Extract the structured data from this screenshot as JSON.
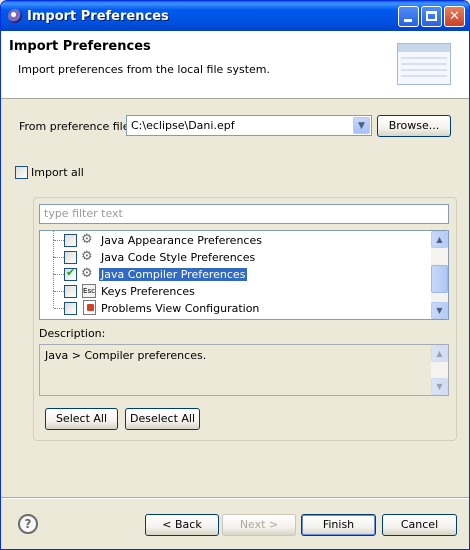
{
  "window": {
    "title": "Import Preferences",
    "close_glyph": "✕"
  },
  "header": {
    "title": "Import Preferences",
    "description": "Import preferences from the local file system.",
    "graphic_icon": "table-graphic"
  },
  "from_file": {
    "label": "From preference file:",
    "value": "C:\\eclipse\\Dani.epf",
    "browse_label": "Browse..."
  },
  "import_all": {
    "label": "Import all",
    "checked": false
  },
  "filter": {
    "placeholder": "type filter text"
  },
  "tree": {
    "items": [
      {
        "label": "Java Appearance Preferences",
        "icon": "java-prefs-icon",
        "checked": false,
        "selected": false
      },
      {
        "label": "Java Code Style Preferences",
        "icon": "java-prefs-icon",
        "checked": false,
        "selected": false
      },
      {
        "label": "Java Compiler Preferences",
        "icon": "java-prefs-icon",
        "checked": true,
        "selected": true
      },
      {
        "label": "Keys Preferences",
        "icon": "keys-icon",
        "checked": false,
        "selected": false
      },
      {
        "label": "Problems View Configuration",
        "icon": "problems-icon",
        "checked": false,
        "selected": false
      }
    ]
  },
  "description": {
    "label": "Description:",
    "text": "Java > Compiler preferences."
  },
  "selection_buttons": {
    "select_all": "Select All",
    "deselect_all": "Deselect All"
  },
  "footer": {
    "help_glyph": "?",
    "back": "< Back",
    "next": "Next >",
    "finish": "Finish",
    "cancel": "Cancel"
  },
  "colors": {
    "titlebar": "#0054e3",
    "selection": "#316ac5",
    "dialog_bg": "#ece9d8"
  }
}
